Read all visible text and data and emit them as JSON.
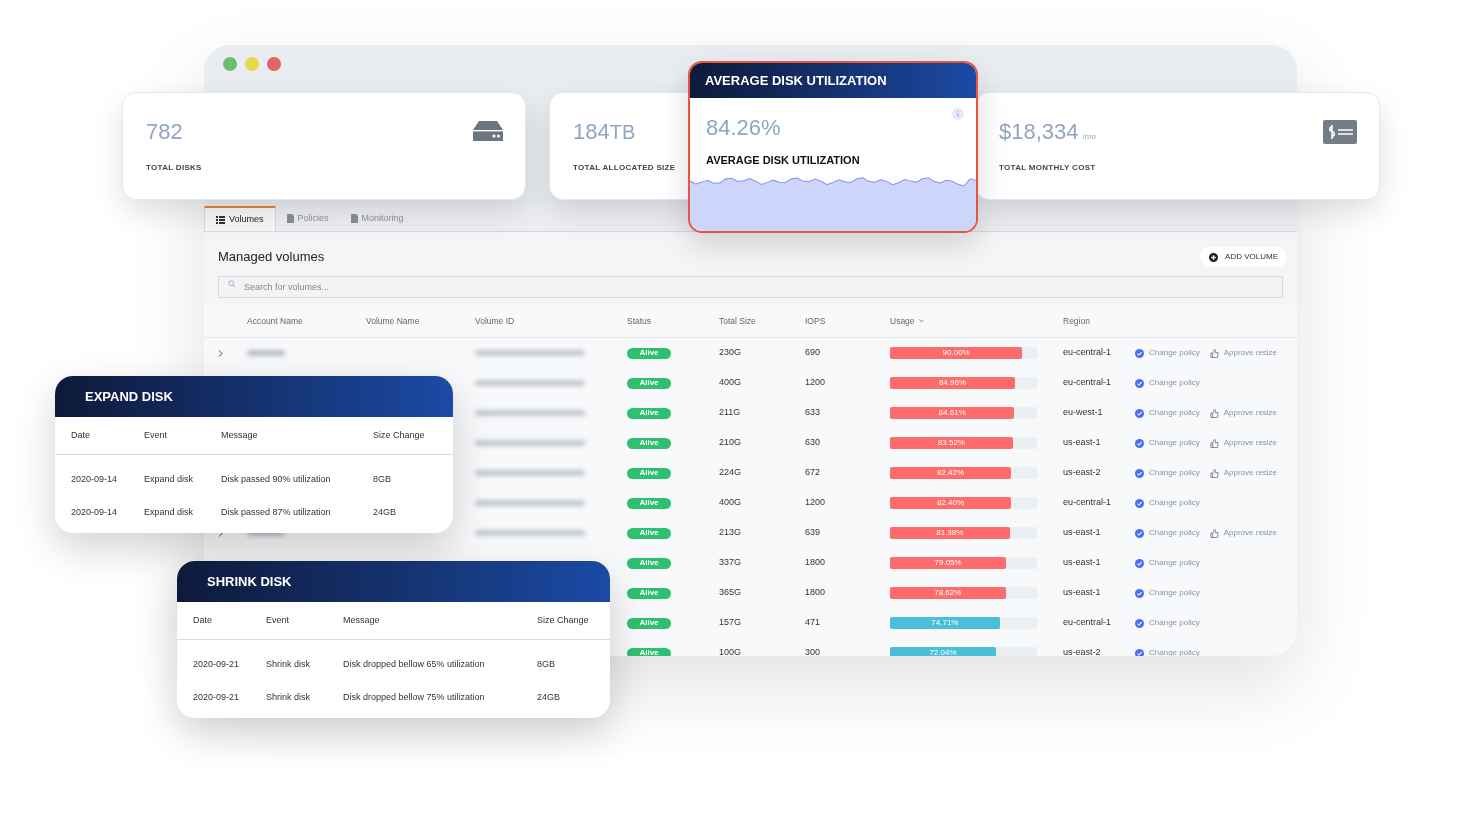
{
  "window": {
    "controls": [
      {
        "color": "#6cbf6a"
      },
      {
        "color": "#e3da45"
      },
      {
        "color": "#e06565"
      }
    ]
  },
  "stat_cards": [
    {
      "value": "782",
      "label": "TOTAL DISKS"
    },
    {
      "value": "184",
      "unit": "TB",
      "label": "TOTAL ALLOCATED SIZE"
    },
    {
      "value": "$18,334",
      "unit": "/mo",
      "label": "TOTAL MONTHLY COST"
    }
  ],
  "utilization_card": {
    "title": "AVERAGE DISK UTILIZATION",
    "value": "84.26%",
    "label": "AVERAGE DISK UTILIZATION"
  },
  "tabs": [
    {
      "label": "Volumes",
      "selected": true
    },
    {
      "label": "Policies",
      "selected": false
    },
    {
      "label": "Monitoring",
      "selected": false
    }
  ],
  "panel": {
    "title": "Managed volumes",
    "add_button": "ADD VOLUME",
    "search": {
      "placeholder": "Search for volumes..."
    }
  },
  "table": {
    "columns": [
      "Account Name",
      "Volume Name",
      "Volume ID",
      "Status",
      "Total Size",
      "IOPS",
      "Usage",
      "Region"
    ],
    "rows": [
      {
        "expandable": true,
        "account_blurred": true,
        "id_blurred": true,
        "status": "Alive",
        "size": "230G",
        "iops": "690",
        "usage": {
          "level": 0.9,
          "label": "90.00%",
          "color": "#ff6b6b"
        },
        "region": "eu-central-1",
        "actions": [
          {
            "kind": "policy",
            "label": "Change policy"
          },
          {
            "kind": "approve",
            "label": "Approve resize"
          }
        ]
      },
      {
        "id_blurred": true,
        "status": "Alive",
        "size": "400G",
        "iops": "1200",
        "usage": {
          "level": 0.8496,
          "label": "84.96%",
          "color": "#ff6b6b"
        },
        "region": "eu-central-1",
        "actions": [
          {
            "kind": "policy",
            "label": "Change policy"
          }
        ]
      },
      {
        "id_blurred": true,
        "status": "Alive",
        "size": "211G",
        "iops": "633",
        "usage": {
          "level": 0.8461,
          "label": "84.61%",
          "color": "#ff6b6b"
        },
        "region": "eu-west-1",
        "actions": [
          {
            "kind": "policy",
            "label": "Change policy"
          },
          {
            "kind": "approve",
            "label": "Approve resize"
          }
        ]
      },
      {
        "id_blurred": true,
        "status": "Alive",
        "size": "210G",
        "iops": "630",
        "usage": {
          "level": 0.8352,
          "label": "83.52%",
          "color": "#ff6b6b"
        },
        "region": "us-east-1",
        "actions": [
          {
            "kind": "policy",
            "label": "Change policy"
          },
          {
            "kind": "approve",
            "label": "Approve resize"
          }
        ]
      },
      {
        "id_blurred": true,
        "status": "Alive",
        "size": "224G",
        "iops": "672",
        "usage": {
          "level": 0.8242,
          "label": "82.42%",
          "color": "#ff6b6b"
        },
        "region": "us-east-2",
        "actions": [
          {
            "kind": "policy",
            "label": "Change policy"
          },
          {
            "kind": "approve",
            "label": "Approve resize"
          }
        ]
      },
      {
        "id_blurred": true,
        "status": "Alive",
        "size": "400G",
        "iops": "1200",
        "usage": {
          "level": 0.824,
          "label": "82.40%",
          "color": "#ff6b6b"
        },
        "region": "eu-central-1",
        "actions": [
          {
            "kind": "policy",
            "label": "Change policy"
          }
        ]
      },
      {
        "expandable": true,
        "account_blurred": true,
        "id_blurred": true,
        "status": "Alive",
        "size": "213G",
        "iops": "639",
        "usage": {
          "level": 0.8138,
          "label": "81.38%",
          "color": "#ff6b6b"
        },
        "region": "us-east-1",
        "actions": [
          {
            "kind": "policy",
            "label": "Change policy"
          },
          {
            "kind": "approve",
            "label": "Approve resize"
          }
        ]
      },
      {
        "status": "Alive",
        "size": "337G",
        "iops": "1800",
        "usage": {
          "level": 0.7905,
          "label": "79.05%",
          "color": "#ff6b6b"
        },
        "region": "us-east-1",
        "actions": [
          {
            "kind": "policy",
            "label": "Change policy"
          }
        ]
      },
      {
        "status": "Alive",
        "size": "365G",
        "iops": "1800",
        "usage": {
          "level": 0.7862,
          "label": "78.62%",
          "color": "#ff6b6b"
        },
        "region": "us-east-1",
        "actions": [
          {
            "kind": "policy",
            "label": "Change policy"
          }
        ]
      },
      {
        "status": "Alive",
        "size": "157G",
        "iops": "471",
        "usage": {
          "level": 0.7471,
          "label": "74.71%",
          "color": "#4bbfd9"
        },
        "region": "eu-central-1",
        "actions": [
          {
            "kind": "policy",
            "label": "Change policy"
          }
        ]
      },
      {
        "status": "Alive",
        "size": "100G",
        "iops": "300",
        "usage": {
          "level": 0.7204,
          "label": "72.04%",
          "color": "#4bbfd9"
        },
        "region": "us-east-2",
        "actions": [
          {
            "kind": "policy",
            "label": "Change policy"
          }
        ]
      }
    ]
  },
  "event_cards": [
    {
      "title": "EXPAND DISK",
      "columns": [
        "Date",
        "Event",
        "Message",
        "Size Change"
      ],
      "rows": [
        [
          "2020-09-14",
          "Expand disk",
          "Disk passed 90% utilization",
          "8GB"
        ],
        [
          "2020-09-14",
          "Expand disk",
          "Disk passed 87% utilization",
          "24GB"
        ]
      ]
    },
    {
      "title": "SHRINK DISK",
      "columns": [
        "Date",
        "Event",
        "Message",
        "Size Change"
      ],
      "rows": [
        [
          "2020-09-21",
          "Shrink disk",
          "Disk dropped bellow 65% utilization",
          "8GB"
        ],
        [
          "2020-09-21",
          "Shrink disk",
          "Disk dropped bellow 75% utilization",
          "24GB"
        ]
      ]
    }
  ]
}
